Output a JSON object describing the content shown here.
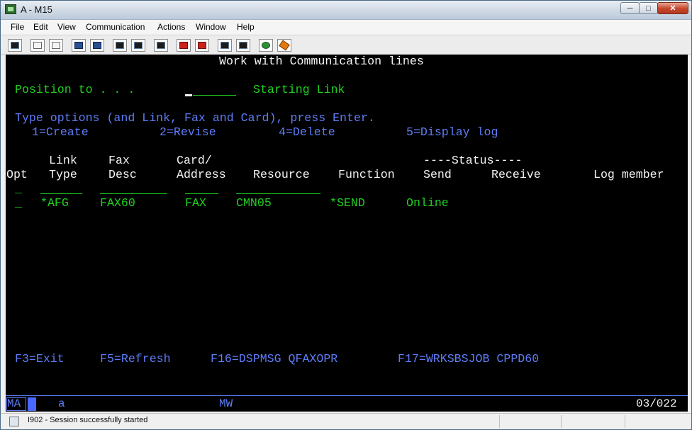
{
  "window": {
    "title": "A - M15",
    "minimize": "─",
    "maximize": "□",
    "close": "✕"
  },
  "menu": [
    "File",
    "Edit",
    "View",
    "Communication",
    "Actions",
    "Window",
    "Help"
  ],
  "screen": {
    "title": "Work with Communication lines",
    "position_label": "Position to . . .",
    "position_value": "",
    "starting_label": "Starting Link",
    "instructions": "Type options (and Link, Fax and Card), press Enter.",
    "options": [
      "1=Create",
      "2=Revise",
      "4=Delete",
      "5=Display log"
    ],
    "headers": {
      "link_top": "Link",
      "fax_top": "Fax",
      "card_top": "Card/",
      "status_top": "----Status----",
      "opt": "Opt",
      "link": "Type",
      "fax": "Desc",
      "card": "Address",
      "resource": "Resource",
      "function": "Function",
      "send": "Send",
      "receive": "Receive",
      "log": "Log member"
    },
    "input_row": {
      "opt": "_"
    },
    "rows": [
      {
        "opt": "_",
        "link_type": "*AFG",
        "fax_desc": "FAX60",
        "card_address": "FAX",
        "resource": "CMN05",
        "function": "*SEND",
        "send": "Online",
        "receive": "",
        "log_member": ""
      }
    ],
    "function_keys": [
      "F3=Exit",
      "F5=Refresh",
      "F16=DSPMSG QFAXOPR",
      "F17=WRKSBSJOB CPPD60"
    ]
  },
  "oia": {
    "ma": "MA",
    "mode": "a",
    "mw": "MW",
    "cursor_pos": "03/022"
  },
  "status": {
    "message": "I902 - Session successfully started"
  },
  "colors": {
    "terminal_bg": "#000000",
    "green": "#20d020",
    "blue": "#5e7df6",
    "white": "#f4f4f4"
  }
}
